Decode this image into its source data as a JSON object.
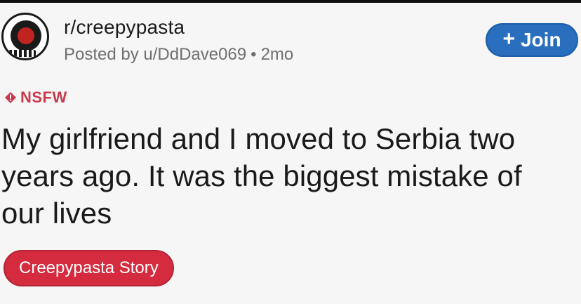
{
  "post": {
    "subreddit": "r/creepypasta",
    "posted_by": "Posted by u/DdDave069",
    "separator": "•",
    "age": "2mo",
    "join_label": "Join",
    "join_icon": "plus-icon",
    "nsfw_label": "NSFW",
    "nsfw_icon": "diamond-icon",
    "title": "My girlfriend and I moved to Serbia two years ago. It was the biggest mistake of our lives",
    "flair": "Creepypasta Story",
    "colors": {
      "join_bg": "#2a6fbe",
      "nsfw": "#c93a4b",
      "flair_bg": "#d42b3f",
      "text": "#1a1a1b",
      "meta": "#6f6f72"
    }
  }
}
